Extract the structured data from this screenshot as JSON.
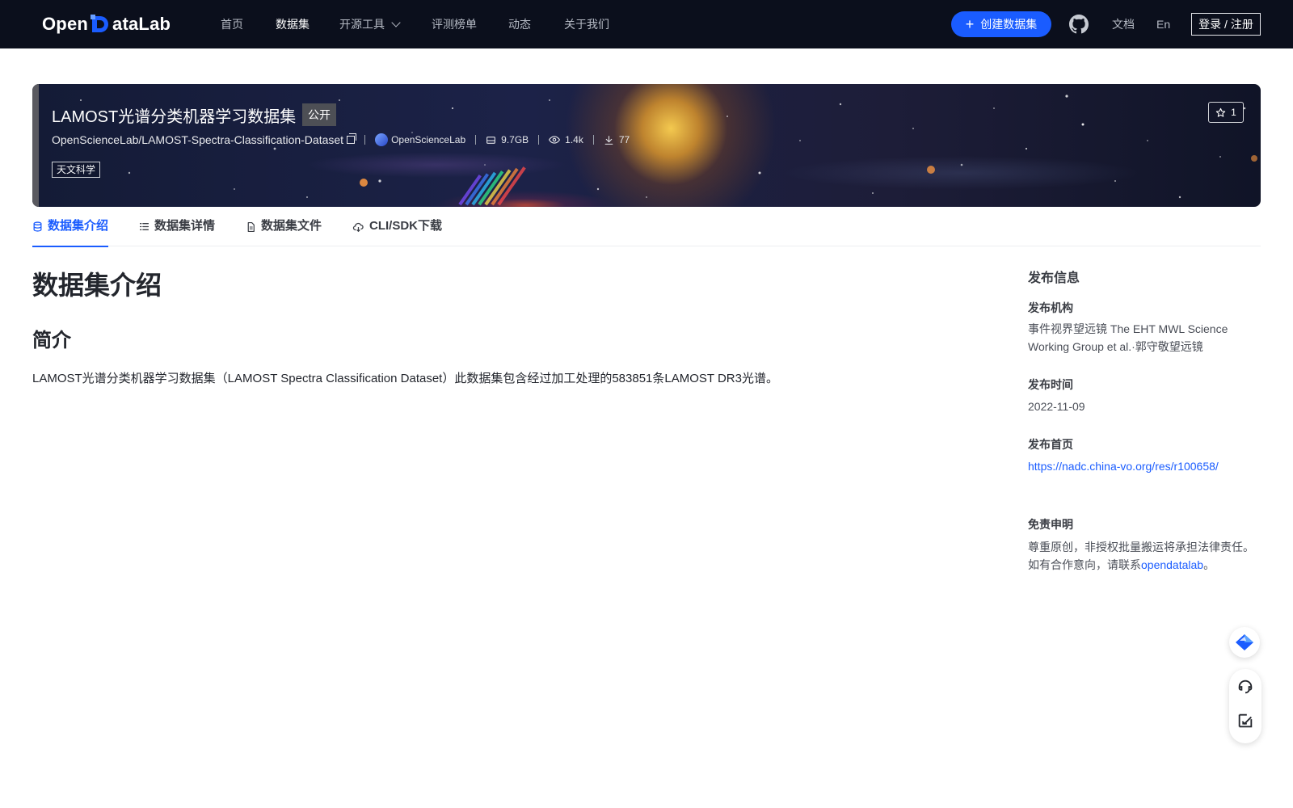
{
  "nav": {
    "brand": "OpenDataLab",
    "items": [
      {
        "label": "首页"
      },
      {
        "label": "数据集"
      },
      {
        "label": "开源工具"
      },
      {
        "label": "评测榜单"
      },
      {
        "label": "动态"
      },
      {
        "label": "关于我们"
      }
    ],
    "create_label": "创建数据集",
    "docs_label": "文档",
    "lang_label": "En",
    "login_label": "登录 / 注册"
  },
  "banner": {
    "title": "LAMOST光谱分类机器学习数据集",
    "visibility": "公开",
    "repo": "OpenScienceLab/LAMOST-Spectra-Classification-Dataset",
    "owner": "OpenScienceLab",
    "size": "9.7GB",
    "views": "1.4k",
    "downloads": "77",
    "stars": "1",
    "tag": "天文科学"
  },
  "tabs": [
    {
      "label": "数据集介绍"
    },
    {
      "label": "数据集详情"
    },
    {
      "label": "数据集文件"
    },
    {
      "label": "CLI/SDK下载"
    }
  ],
  "content": {
    "heading": "数据集介绍",
    "subheading": "简介",
    "description": "LAMOST光谱分类机器学习数据集（LAMOST Spectra Classification Dataset）此数据集包含经过加工处理的583851条LAMOST DR3光谱。"
  },
  "sidebar": {
    "title": "发布信息",
    "org_label": "发布机构",
    "org_value": "事件视界望远镜 The EHT MWL Science Working Group et al.·郭守敬望远镜",
    "date_label": "发布时间",
    "date_value": "2022-11-09",
    "home_label": "发布首页",
    "home_url": "https://nadc.china-vo.org/res/r100658/",
    "disclaimer_label": "免责申明",
    "disclaimer_line1": "尊重原创，非授权批量搬运将承担法律责任。",
    "disclaimer_line2_prefix": "如有合作意向，请联系",
    "disclaimer_link": "opendatalab",
    "disclaimer_line2_suffix": "。"
  },
  "colors": {
    "primary": "#1a5cff",
    "topbar": "#0b0f1c"
  }
}
